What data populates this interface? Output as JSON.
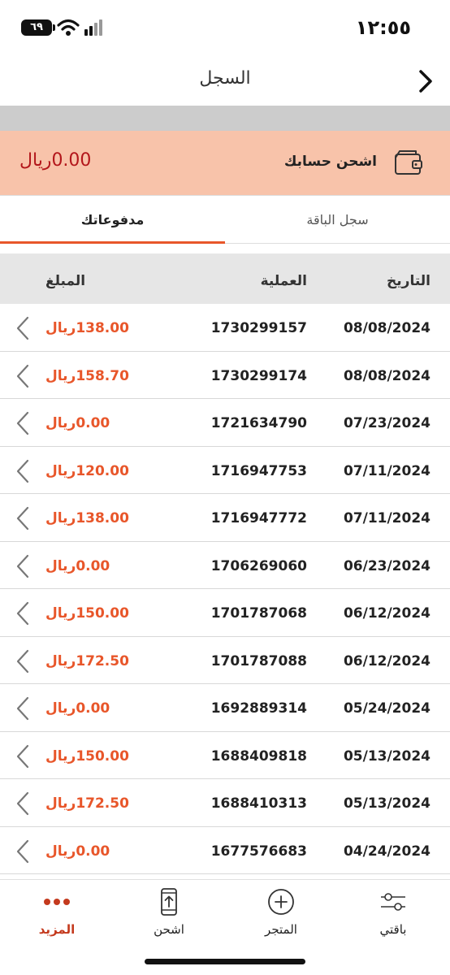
{
  "status_bar": {
    "time": "١٢:٥٥",
    "battery": "٦٩"
  },
  "header": {
    "title": "السجل"
  },
  "recharge": {
    "label": "اشحن حسابك",
    "balance": "0.00ريال"
  },
  "tabs": [
    {
      "label": "مدفوعاتك",
      "active": true
    },
    {
      "label": "سجل الباقة",
      "active": false
    }
  ],
  "table": {
    "columns": {
      "date": "التاريخ",
      "operation": "العملية",
      "amount": "المبلغ"
    },
    "rows": [
      {
        "date": "08/08/2024",
        "operation": "1730299157",
        "amount": "138.00ريال"
      },
      {
        "date": "08/08/2024",
        "operation": "1730299174",
        "amount": "158.70ريال"
      },
      {
        "date": "07/23/2024",
        "operation": "1721634790",
        "amount": "0.00ريال"
      },
      {
        "date": "07/11/2024",
        "operation": "1716947753",
        "amount": "120.00ريال"
      },
      {
        "date": "07/11/2024",
        "operation": "1716947772",
        "amount": "138.00ريال"
      },
      {
        "date": "06/23/2024",
        "operation": "1706269060",
        "amount": "0.00ريال"
      },
      {
        "date": "06/12/2024",
        "operation": "1701787068",
        "amount": "150.00ريال"
      },
      {
        "date": "06/12/2024",
        "operation": "1701787088",
        "amount": "172.50ريال"
      },
      {
        "date": "05/24/2024",
        "operation": "1692889314",
        "amount": "0.00ريال"
      },
      {
        "date": "05/13/2024",
        "operation": "1688409818",
        "amount": "150.00ريال"
      },
      {
        "date": "05/13/2024",
        "operation": "1688410313",
        "amount": "172.50ريال"
      },
      {
        "date": "04/24/2024",
        "operation": "1677576683",
        "amount": "0.00ريال"
      }
    ]
  },
  "bottom_nav": {
    "more": "المزيد",
    "recharge": "اشحن",
    "store": "المتجر",
    "package": "باقتي"
  },
  "colors": {
    "accent": "#e8562a",
    "banner": "#f8c3aa",
    "balance": "#b3161b",
    "active_nav": "#c43a1e"
  }
}
